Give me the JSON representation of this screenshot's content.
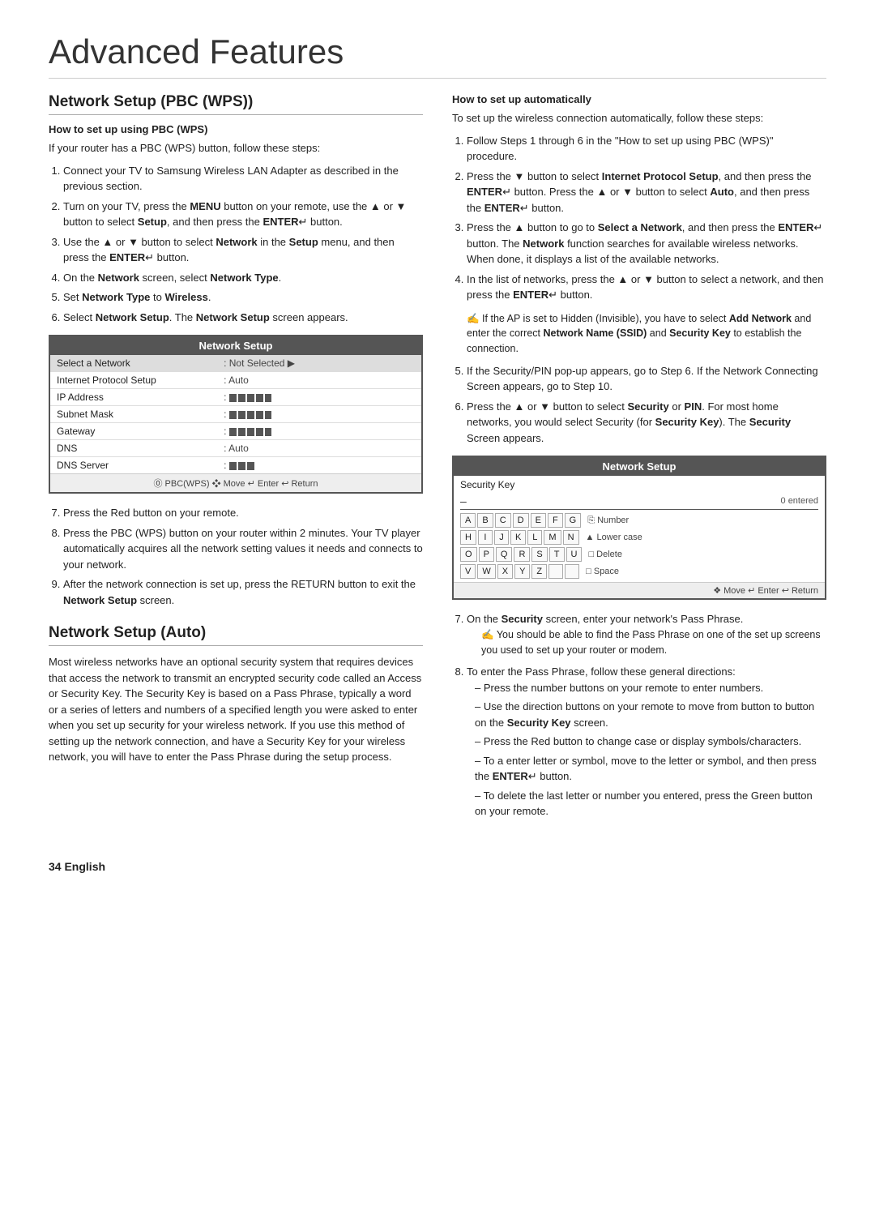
{
  "page": {
    "title": "Advanced Features",
    "page_number": "34",
    "page_language": "English"
  },
  "left_column": {
    "section1_title": "Network Setup (PBC (WPS))",
    "subsection1_title": "How to set up using PBC (WPS)",
    "intro": "If your router has a PBC (WPS) button, follow these steps:",
    "steps": [
      "Connect your TV to Samsung Wireless LAN Adapter as described in the previous section.",
      "Turn on your TV, press the MENU button on your remote, use the ▲ or ▼ button to select Setup, and then press the ENTER button.",
      "Use the ▲ or ▼ button to select Network in the Setup menu, and then press the ENTER button.",
      "On the Network screen, select Network Type.",
      "Set Network Type to Wireless.",
      "Select Network Setup. The Network Setup screen appears."
    ],
    "network_setup_box": {
      "title": "Network Setup",
      "rows": [
        {
          "label": "Select a Network",
          "value": ": Not Selected ▶",
          "highlight": true
        },
        {
          "label": "Internet Protocol Setup",
          "value": ": Auto"
        },
        {
          "label": "IP Address",
          "value": ":"
        },
        {
          "label": "Subnet Mask",
          "value": ":"
        },
        {
          "label": "Gateway",
          "value": ":"
        },
        {
          "label": "DNS",
          "value": ": Auto"
        },
        {
          "label": "DNS Server",
          "value": ":"
        }
      ],
      "footer": "⓪ PBC(WPS)  ❖ Move  ↵ Enter  ↩ Return"
    },
    "steps_after_box": [
      "Press the Red button on your remote.",
      "Press the PBC (WPS) button on your router within 2 minutes. Your TV player automatically acquires all the network setting values it needs and connects to your network.",
      "After the network connection is set up, press the RETURN button to exit the Network Setup screen."
    ],
    "section2_title": "Network Setup (Auto)",
    "section2_body": "Most wireless networks have an optional security system that requires devices that access the network to transmit an encrypted security code called an Access or Security Key. The Security Key is based on a Pass Phrase, typically a word or a series of letters and numbers of a specified length you were asked to enter when you set up security for your wireless network. If you use this method of setting up the network connection, and have a Security Key for your wireless network, you will have to enter the Pass Phrase during the setup process."
  },
  "right_column": {
    "subsection_title": "How to set up automatically",
    "intro": "To set up the wireless connection automatically, follow these steps:",
    "steps": [
      "Follow Steps 1 through 6 in the \"How to set up using PBC (WPS)\" procedure.",
      "Press the ▼ button to select Internet Protocol Setup, and then press the ENTER button. Press the ▲ or ▼ button to select Auto, and then press the ENTER button.",
      "Press the ▲ button to go to Select a Network, and then press the ENTER button. The Network function searches for available wireless networks. When done, it displays a list of the available networks.",
      "In the list of networks, press the ▲ or ▼ button to select a network, and then press the ENTER button.",
      "If the Security/PIN pop-up appears, go to Step 6. If the Network Connecting Screen appears, go to Step 10.",
      "Press the ▲ or ▼ button to select Security or PIN. For most home networks, you would select Security (for Security Key). The Security Screen appears."
    ],
    "note1": "If the AP is set to Hidden (Invisible), you have to select Add Network and enter the correct Network Name (SSID) and Security Key to establish the connection.",
    "security_box": {
      "title": "Network Setup",
      "key_label": "Security Key",
      "dash": "–",
      "entered": "0 entered",
      "rows": [
        {
          "keys": [
            "A",
            "B",
            "C",
            "D",
            "E",
            "F",
            "G"
          ],
          "side_label": "Number"
        },
        {
          "keys": [
            "H",
            "I",
            "J",
            "K",
            "L",
            "M",
            "N"
          ],
          "side_label": "▲ Lower case"
        },
        {
          "keys": [
            "O",
            "P",
            "Q",
            "R",
            "S",
            "T",
            "U"
          ],
          "side_label": "□ Delete"
        },
        {
          "keys": [
            "V",
            "W",
            "X",
            "Y",
            "Z",
            "",
            ""
          ],
          "side_label": "□ Space"
        }
      ],
      "footer": "❖ Move  ↵ Enter  ↩ Return"
    },
    "steps_after_box": [
      "On the Security screen, enter your network's Pass Phrase.",
      "To enter the Pass Phrase, follow these general directions:"
    ],
    "note2": "You should be able to find the Pass Phrase on one of the set up screens you used to set up your router or modem.",
    "directions": [
      "Press the number buttons on your remote to enter numbers.",
      "Use the direction buttons on your remote to move from button to button on the Security Key screen.",
      "Press the Red button to change case or display symbols/characters.",
      "To a enter letter or symbol, move to the letter or symbol, and then press the ENTER button.",
      "To delete the last letter or number you entered, press the Green button on your remote."
    ]
  }
}
